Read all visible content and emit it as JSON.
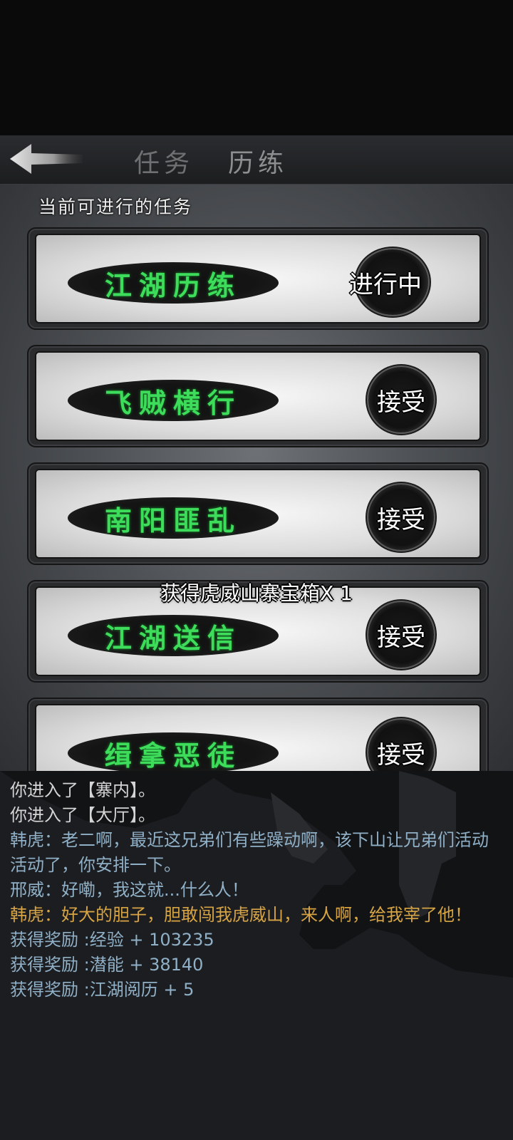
{
  "header": {
    "tabs": [
      {
        "label": "任务",
        "active": false
      },
      {
        "label": "历练",
        "active": true
      }
    ]
  },
  "panel": {
    "title": "当前可进行的任务",
    "quests": [
      {
        "name": "江湖历练",
        "action": "进行中"
      },
      {
        "name": "飞贼横行",
        "action": "接受"
      },
      {
        "name": "南阳匪乱",
        "action": "接受"
      },
      {
        "name": "江湖送信",
        "action": "接受"
      },
      {
        "name": "缉拿恶徒",
        "action": "接受"
      }
    ]
  },
  "toast": "获得虎威山寨宝箱X 1",
  "log": [
    {
      "text": "你进入了【寨内】。",
      "color": "white"
    },
    {
      "text": "你进入了【大厅】。",
      "color": "white"
    },
    {
      "text": "韩虎：老二啊，最近这兄弟们有些躁动啊，该下山让兄弟们活动活动了，你安排一下。",
      "color": "blue"
    },
    {
      "text": "邢威：好嘞，我这就...什么人！",
      "color": "blue"
    },
    {
      "text": "韩虎：好大的胆子，胆敢闯我虎威山，来人啊，给我宰了他！",
      "color": "gold"
    },
    {
      "text": "获得奖励 :经验 + 103235",
      "color": "blue"
    },
    {
      "text": "获得奖励 :潜能 + 38140",
      "color": "blue"
    },
    {
      "text": "获得奖励 :江湖阅历 + 5",
      "color": "blue"
    }
  ],
  "colors": {
    "quest_text": "#3ddc5a",
    "log_white": "#d4d4d4",
    "log_blue": "#8fb0c7",
    "log_gold": "#d7a443"
  }
}
